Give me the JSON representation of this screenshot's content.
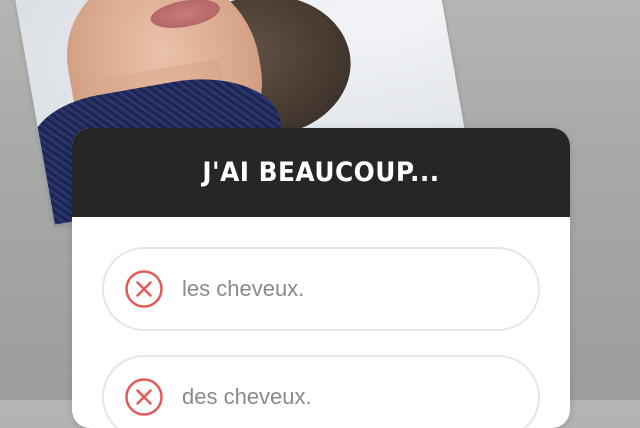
{
  "quiz": {
    "question": "J'AI BEAUCOUP...",
    "options": [
      {
        "label": "les cheveux.",
        "icon": "x-circle-icon",
        "state": "wrong"
      },
      {
        "label": "des cheveux.",
        "icon": "x-circle-icon",
        "state": "wrong"
      }
    ]
  },
  "colors": {
    "header_bg": "#262626",
    "wrong_icon": "#e35a5a",
    "option_text": "#8a8a8a"
  }
}
